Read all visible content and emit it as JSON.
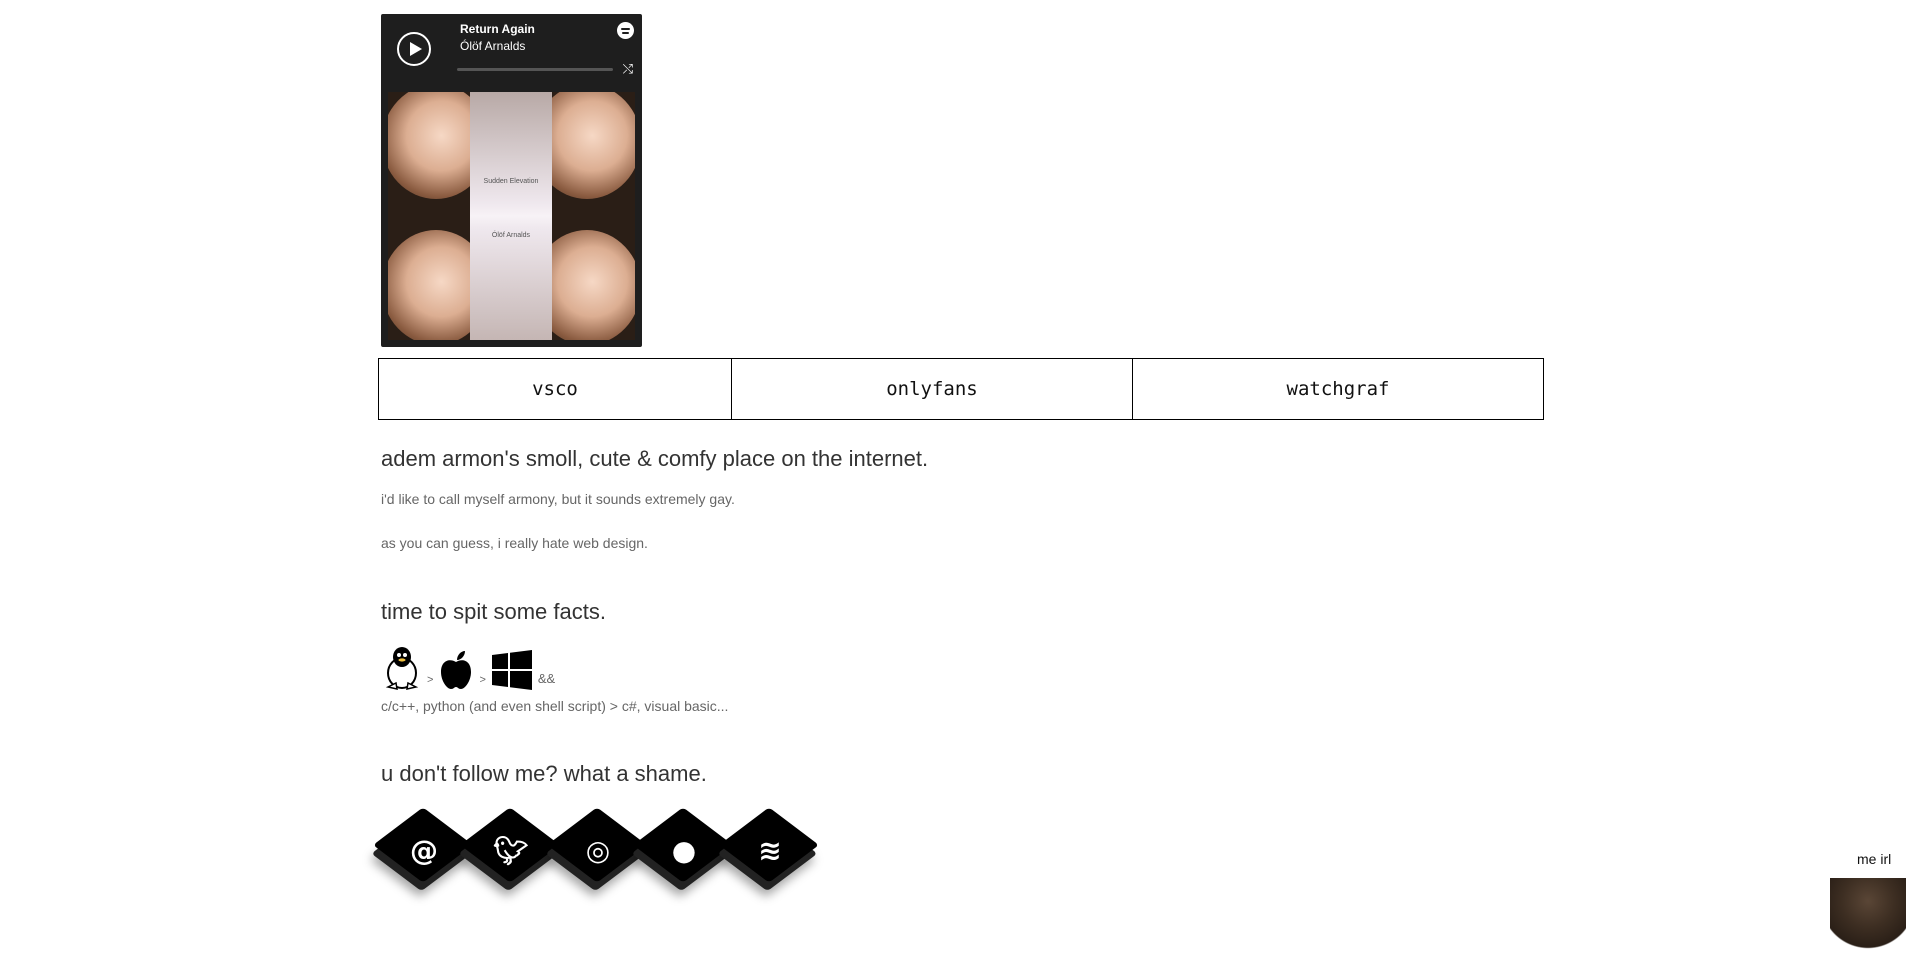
{
  "player": {
    "title": "Return Again",
    "artist": "Ólöf Arnalds",
    "share_icon": "share-icon",
    "album_art_text_1": "Sudden Elevation",
    "album_art_text_2": "Ólöf Arnalds"
  },
  "nav": {
    "items": [
      {
        "label": "vsco"
      },
      {
        "label": "onlyfans"
      },
      {
        "label": "watchgraf"
      }
    ]
  },
  "intro": {
    "heading": "adem armon's smoll, cute & comfy place on the internet.",
    "line1": "i'd like to call myself armony, but it sounds extremely gay.",
    "line2": "as you can guess, i really hate web design."
  },
  "facts": {
    "heading": "time to spit some facts.",
    "gt1": ">",
    "gt2": ">",
    "amp": "&&",
    "langs": "c/c++, python (and even shell script) > c#, visual basic..."
  },
  "follow": {
    "heading": "u don't follow me? what a shame.",
    "icons": [
      "at-icon",
      "twitter-icon",
      "instagram-icon",
      "github-icon",
      "spotify-icon"
    ]
  },
  "corner": {
    "label": "me irl"
  }
}
